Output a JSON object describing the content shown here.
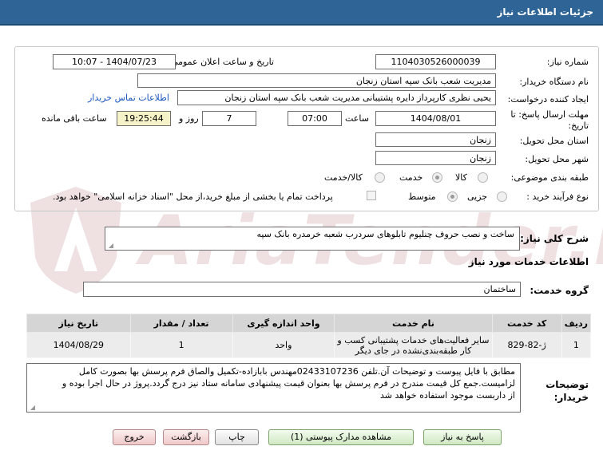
{
  "header": {
    "title": "جزئیات اطلاعات نیاز"
  },
  "watermark": {
    "text": "AriaTender.net"
  },
  "form": {
    "need_number_label": "شماره نیاز:",
    "need_number": "1104030526000039",
    "announce_label": "تاریخ و ساعت اعلان عمومی:",
    "announce_value": "1404/07/23 - 10:07",
    "buyer_org_label": "نام دستگاه خریدار:",
    "buyer_org": "مدیریت شعب بانک سپه استان زنجان",
    "requester_label": "ایجاد کننده درخواست:",
    "requester": "یحیی نظری کارپرداز دایره پشتیبانی  مدیریت شعب بانک سپه استان زنجان",
    "buyer_contact_link": "اطلاعات تماس خریدار",
    "deadline_label": "مهلت ارسال پاسخ: تا تاریخ:",
    "deadline_date": "1404/08/01",
    "time_label": "ساعت",
    "deadline_time": "07:00",
    "days_count": "7",
    "days_label": "روز و",
    "remaining_time": "19:25:44",
    "remaining_label": "ساعت باقی مانده",
    "province_label": "استان محل تحویل:",
    "province": "زنجان",
    "city_label": "شهر محل تحویل:",
    "city": "زنجان",
    "category_label": "طبقه بندی موضوعی:",
    "category_options": [
      "کالا",
      "خدمت",
      "کالا/خدمت"
    ],
    "category_selected": "خدمت",
    "process_label": "نوع فرآیند خرید :",
    "process_options": [
      "جزیی",
      "متوسط"
    ],
    "process_selected": "متوسط",
    "payment_note": "پرداخت تمام یا بخشی از مبلغ خرید،از محل \"اسناد خزانه اسلامی\" خواهد بود."
  },
  "description": {
    "label": "شرح کلی نیاز:",
    "value": "ساخت و نصب حروف چنلیوم تابلوهای سردرب شعبه خرمدره بانک سپه"
  },
  "services": {
    "section_title": "اطلاعات خدمات مورد نیاز",
    "group_label": "گروه خدمت:",
    "group_value": "ساختمان",
    "table": {
      "headers": [
        "ردیف",
        "کد خدمت",
        "نام خدمت",
        "واحد اندازه گیری",
        "تعداد / مقدار",
        "تاریخ نیاز"
      ],
      "rows": [
        {
          "row": "1",
          "code": "ژ-82-829",
          "name": "سایر فعالیت‌های خدمات پشتیبانی کسب و کار طبقه‌بندی‌نشده در جای دیگر",
          "unit": "واحد",
          "qty": "1",
          "date": "1404/08/29"
        }
      ]
    }
  },
  "buyer_notes": {
    "label": "توضیحات خریدار:",
    "lines": [
      "مطابق با فایل پیوست و توضیحات آن.تلفن 02433107236مهندس بابازاده-تکمیل والصاق فرم پرسش بها بصورت کامل",
      "لزامیست.جمع کل قیمت مندرج در فرم پرسش بها بعنوان قیمت پیشنهادی سامانه ستاد نیز درج گردد.پروژ در حال اجرا بوده و",
      "از داربست موجود استفاده خواهد شد"
    ]
  },
  "buttons": {
    "reply": "پاسخ به نیاز",
    "attachments": "مشاهده مدارک پیوستی (1)",
    "print": "چاپ",
    "back": "بازگشت",
    "exit": "خروج"
  }
}
